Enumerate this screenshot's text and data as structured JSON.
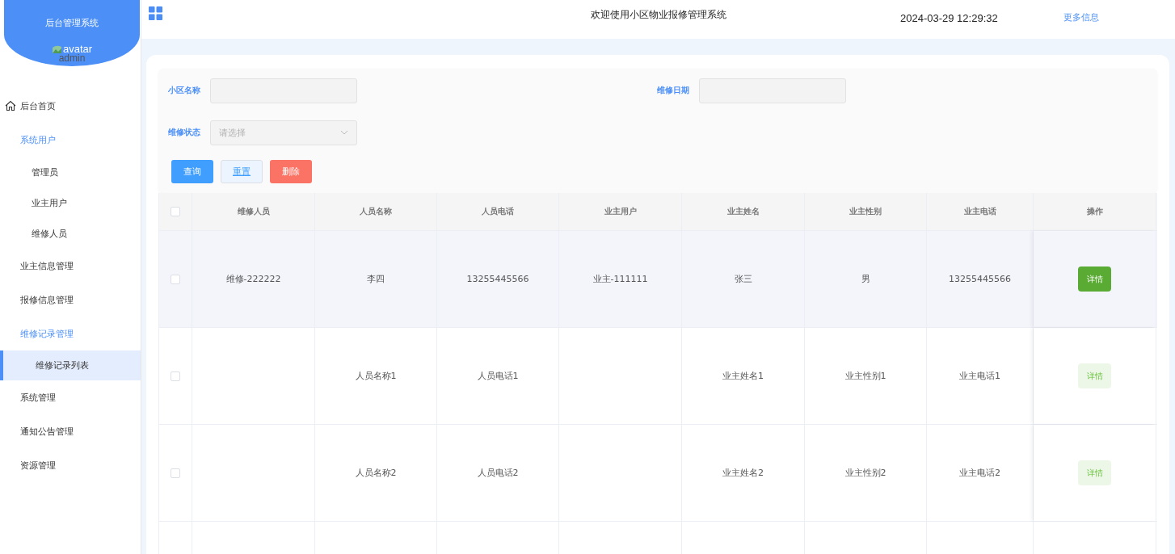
{
  "sidebar": {
    "title": "后台管理系统",
    "avatar_alt": "avatar",
    "username": "admin",
    "items": [
      {
        "label": "后台首页",
        "expanded": false,
        "selected": false
      },
      {
        "label": "系统用户",
        "expanded": true,
        "selected": false,
        "children": [
          {
            "label": "管理员",
            "selected": false
          },
          {
            "label": "业主用户",
            "selected": false
          },
          {
            "label": "维修人员",
            "selected": false
          }
        ]
      },
      {
        "label": "业主信息管理",
        "expanded": false,
        "selected": false
      },
      {
        "label": "报修信息管理",
        "expanded": false,
        "selected": false
      },
      {
        "label": "维修记录管理",
        "expanded": true,
        "selected": false,
        "children": [
          {
            "label": "维修记录列表",
            "selected": true
          }
        ]
      },
      {
        "label": "系统管理",
        "expanded": false,
        "selected": false
      },
      {
        "label": "通知公告管理",
        "expanded": false,
        "selected": false
      },
      {
        "label": "资源管理",
        "expanded": false,
        "selected": false
      }
    ]
  },
  "header": {
    "title": "欢迎使用小区物业报修管理系统",
    "datetime": "2024-03-29 12:29:32",
    "more_link": "更多信息"
  },
  "search": {
    "fields": [
      {
        "label": "小区名称",
        "kind": "text"
      },
      {
        "label": "维修日期",
        "kind": "text"
      },
      {
        "label": "维修状态",
        "kind": "select",
        "placeholder": "请选择"
      }
    ],
    "buttons": [
      {
        "label": "查询",
        "kind": "primary"
      },
      {
        "label": "重置",
        "kind": "plain"
      },
      {
        "label": "删除",
        "kind": "danger"
      }
    ]
  },
  "table": {
    "all_checked": false,
    "columns": [
      "维修人员",
      "人员名称",
      "人员电话",
      "业主用户",
      "业主姓名",
      "业主性别",
      "业主电话",
      "操作"
    ],
    "rows": [
      {
        "hovered": true,
        "checked": false,
        "cells": [
          "维修-222222",
          "李四",
          "13255445566",
          "业主-111111",
          "张三",
          "男",
          "13255445566"
        ],
        "action": "详情"
      },
      {
        "hovered": false,
        "checked": false,
        "cells": [
          "",
          "人员名称1",
          "人员电话1",
          "",
          "业主姓名1",
          "业主性别1",
          "业主电话1"
        ],
        "action": "详情"
      },
      {
        "hovered": false,
        "checked": false,
        "cells": [
          "",
          "人员名称2",
          "人员电话2",
          "",
          "业主姓名2",
          "业主性别2",
          "业主电话2"
        ],
        "action": "详情"
      }
    ]
  }
}
